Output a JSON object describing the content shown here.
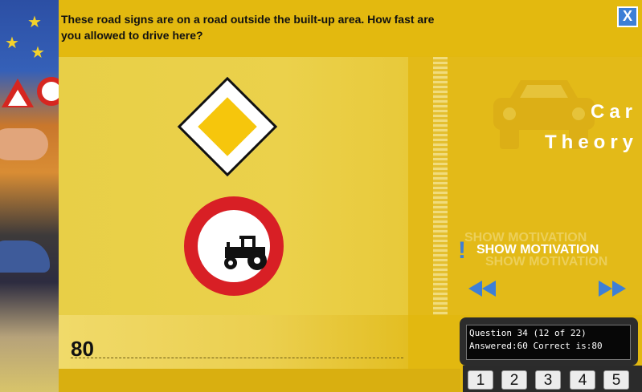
{
  "question": {
    "text": "These road signs are on a road outside the built-up area. How fast are you allowed to drive here?"
  },
  "close_button": {
    "label": "X"
  },
  "signs": [
    {
      "icon": "priority-road-sign-icon"
    },
    {
      "icon": "no-tractors-sign-icon"
    }
  ],
  "brand": {
    "line1": "Car",
    "line2": "Theory"
  },
  "motivation": {
    "label": "SHOW MOTIVATION",
    "ghost_label": "SHOW MOTIVATION",
    "icon": "exclamation-icon"
  },
  "navigation": {
    "prev_icon": "rewind-icon",
    "next_icon": "fast-forward-icon"
  },
  "answer": {
    "value": "80"
  },
  "status": {
    "line1": "Question 34 (12 of 22)",
    "line2": "Answered:60 Correct is:80"
  },
  "keypad": [
    "1",
    "2",
    "3",
    "4",
    "5"
  ],
  "colors": {
    "background": "#e2b810",
    "accent_blue": "#3d7fd6",
    "sign_red": "#d81f25",
    "sign_yellow": "#f6c60c"
  }
}
